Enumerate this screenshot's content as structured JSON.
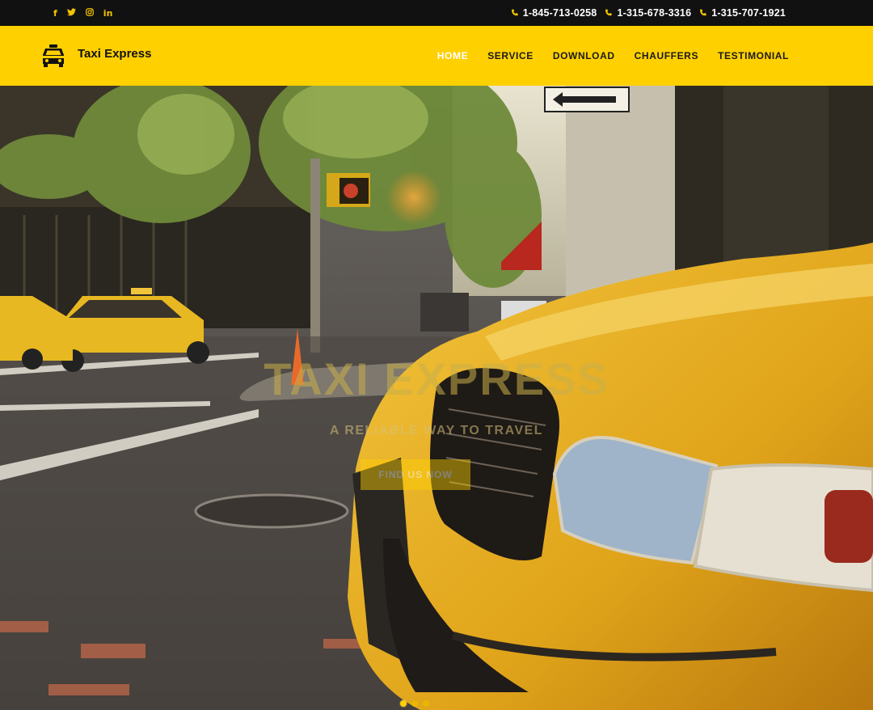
{
  "social": {
    "facebook": "f",
    "twitter": "t",
    "instagram": "◎",
    "linkedin": "in"
  },
  "phones": [
    "1-845-713-0258",
    "1-315-678-3316",
    "1-315-707-1921"
  ],
  "brand": {
    "name": "Taxi Express",
    "icon": "taxi-icon"
  },
  "nav": [
    {
      "label": "Home",
      "active": true
    },
    {
      "label": "Service",
      "active": false
    },
    {
      "label": "Download",
      "active": false
    },
    {
      "label": "Chauffers",
      "active": false
    },
    {
      "label": "Testimonial",
      "active": false
    }
  ],
  "hero": {
    "title": "TAXI EXPRESS",
    "subtitle": "A reliable way to travel",
    "button": "Find us now",
    "slides": 3,
    "active_slide": 0
  },
  "colors": {
    "accent": "#ffd000",
    "topbar": "#111111"
  }
}
